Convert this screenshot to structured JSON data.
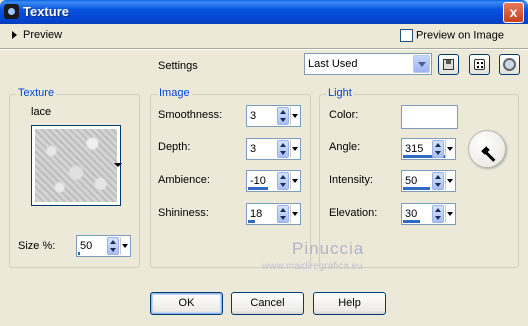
{
  "window": {
    "title": "Texture",
    "close_label": "x"
  },
  "preview": {
    "label": "Preview",
    "preview_on_image_label": "Preview on Image",
    "preview_on_image_checked": false
  },
  "settings": {
    "label": "Settings",
    "value": "Last Used"
  },
  "icons": [
    "save-preset-icon",
    "randomize-dice-icon",
    "reset-icon"
  ],
  "texture": {
    "title": "Texture",
    "name": "lace",
    "size_label": "Size %:",
    "size_value": "50"
  },
  "image": {
    "title": "Image",
    "smoothness_label": "Smoothness:",
    "smoothness_value": "3",
    "depth_label": "Depth:",
    "depth_value": "3",
    "ambience_label": "Ambience:",
    "ambience_value": "-10",
    "shininess_label": "Shininess:",
    "shininess_value": "18"
  },
  "light": {
    "title": "Light",
    "color_label": "Color:",
    "color_value": "#ffffff",
    "angle_label": "Angle:",
    "angle_value": "315",
    "intensity_label": "Intensity:",
    "intensity_value": "50",
    "elevation_label": "Elevation:",
    "elevation_value": "30"
  },
  "watermark": {
    "name": "Pinuccia",
    "url": "www.maidiregrafica.eu"
  },
  "buttons": {
    "ok": "OK",
    "cancel": "Cancel",
    "help": "Help"
  }
}
